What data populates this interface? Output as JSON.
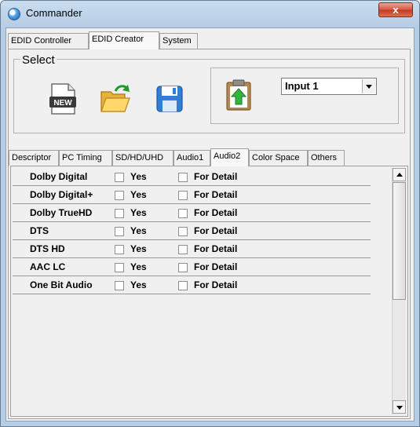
{
  "window": {
    "title": "Commander",
    "close_label": "x"
  },
  "top_tabs": [
    {
      "label": "EDID Controller"
    },
    {
      "label": "EDID Creator"
    },
    {
      "label": "System"
    }
  ],
  "select_group": {
    "label": "Select",
    "buttons": [
      {
        "name": "new-button",
        "icon": "new-file-icon",
        "badge": "NEW"
      },
      {
        "name": "open-button",
        "icon": "open-folder-icon"
      },
      {
        "name": "save-button",
        "icon": "floppy-disk-icon"
      },
      {
        "name": "paste-button",
        "icon": "clipboard-upload-icon"
      }
    ],
    "input_select": {
      "value": "Input 1"
    }
  },
  "sub_tabs": [
    {
      "label": "Descriptor"
    },
    {
      "label": "PC Timing"
    },
    {
      "label": "SD/HD/UHD"
    },
    {
      "label": "Audio1"
    },
    {
      "label": "Audio2"
    },
    {
      "label": "Color Space"
    },
    {
      "label": "Others"
    }
  ],
  "audio_rows": [
    {
      "label": "Dolby Digital",
      "yes": "Yes",
      "detail": "For Detail"
    },
    {
      "label": "Dolby Digital+",
      "yes": "Yes",
      "detail": "For Detail"
    },
    {
      "label": "Dolby TrueHD",
      "yes": "Yes",
      "detail": "For Detail"
    },
    {
      "label": "DTS",
      "yes": "Yes",
      "detail": "For Detail"
    },
    {
      "label": "DTS HD",
      "yes": "Yes",
      "detail": "For Detail"
    },
    {
      "label": "AAC LC",
      "yes": "Yes",
      "detail": "For Detail"
    },
    {
      "label": "One Bit Audio",
      "yes": "Yes",
      "detail": "For Detail"
    }
  ]
}
